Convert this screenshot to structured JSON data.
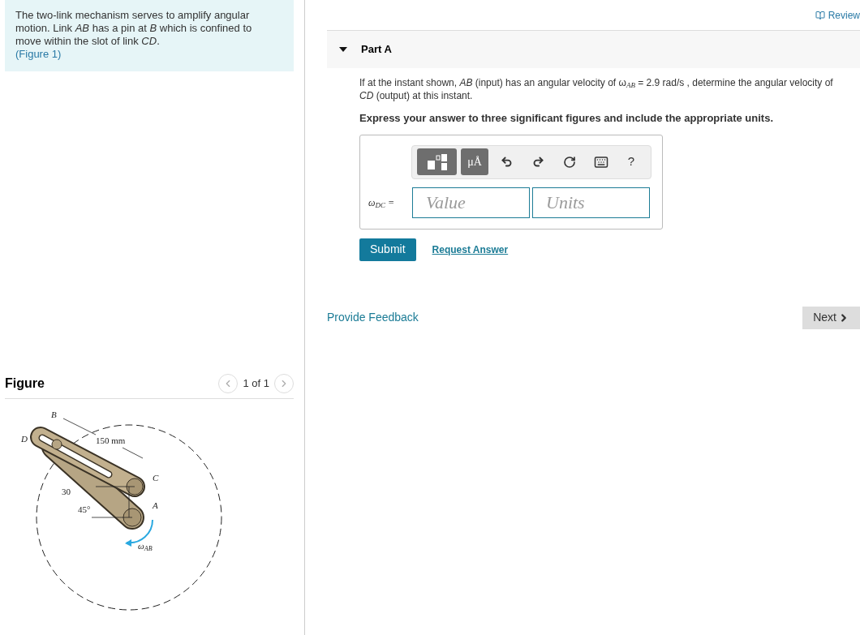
{
  "problem": {
    "text": "The two-link mechanism serves to amplify angular motion. Link *AB* has a pin at *B* which is confined to move within the slot of link *CD*.",
    "figure_link": "(Figure 1)"
  },
  "figure": {
    "title": "Figure",
    "pager": "1 of 1",
    "labels": [
      "B",
      "D",
      "150 mm",
      "C",
      "30",
      "45°",
      "A",
      "ω$_{AB}$"
    ]
  },
  "review": "Review",
  "part": {
    "title": "Part A",
    "expanded": true,
    "question": "If at the instant shown, *AB* (input) has an angular velocity of ω$_{AB}$ = 2.9 rad/s , determine the angular velocity of *CD* (output) at this instant.",
    "instruction": "Express your answer to three significant figures and include the appropriate units.",
    "toolbar": {
      "units_button": "μÅ",
      "help": "?"
    },
    "answer": {
      "label": "ω$_{DC}$ =",
      "value_placeholder": "Value",
      "units_placeholder": "Units"
    },
    "submit": "Submit",
    "request": "Request Answer"
  },
  "feedback": "Provide Feedback",
  "next": "Next"
}
